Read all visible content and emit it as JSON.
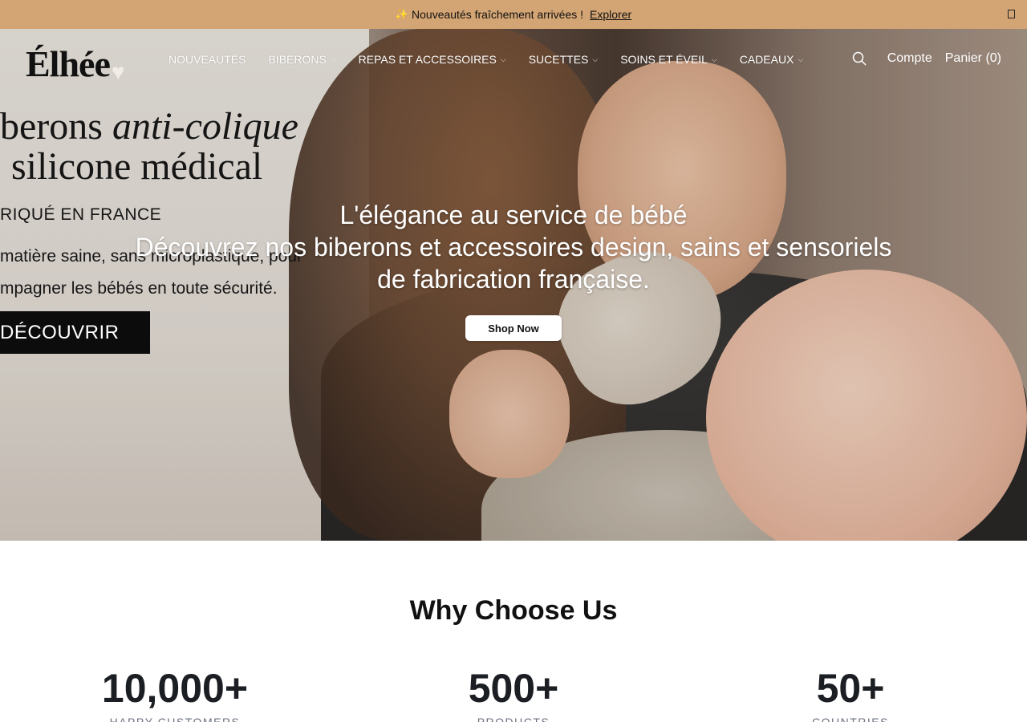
{
  "announcement": {
    "icon": "sparkles-icon",
    "text": "Nouveautés fraîchement arrivées !",
    "link": "Explorer"
  },
  "header": {
    "logo": "Élhée",
    "nav": [
      {
        "label": "NOUVEAUTÉS",
        "has_dropdown": false
      },
      {
        "label": "BIBERONS",
        "has_dropdown": true
      },
      {
        "label": "REPAS ET ACCESSOIRES",
        "has_dropdown": true
      },
      {
        "label": "SUCETTES",
        "has_dropdown": true
      },
      {
        "label": "SOINS ET ÉVEIL",
        "has_dropdown": true
      },
      {
        "label": "CADEAUX",
        "has_dropdown": true
      }
    ],
    "account": "Compte",
    "cart": "Panier (0)"
  },
  "banner_image": {
    "line1a": "berons ",
    "line1b": "anti-colique",
    "line2": "silicone médical",
    "line3": "RIQUÉ EN FRANCE",
    "line4a": "matière saine, sans microplastique, pour",
    "line4b": "mpagner les bébés en toute sécurité.",
    "button": "DÉCOUVRIR"
  },
  "hero": {
    "title": "L'élégance au service de bébé",
    "subtitle1": "Découvrez nos biberons et accessoires design, sains et sensoriels",
    "subtitle2": "de fabrication française.",
    "cta": "Shop Now"
  },
  "why": {
    "title": "Why Choose Us",
    "stats": [
      {
        "value": "10,000+",
        "label": "HAPPY CUSTOMERS"
      },
      {
        "value": "500+",
        "label": "PRODUCTS"
      },
      {
        "value": "50+",
        "label": "COUNTRIES"
      }
    ]
  },
  "colors": {
    "announcement_bg": "#d4a574",
    "text_dark": "#111111"
  }
}
